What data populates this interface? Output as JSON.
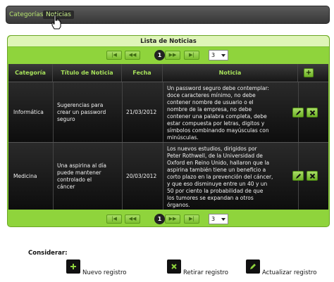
{
  "menu": {
    "items": [
      {
        "label": "Categorías"
      },
      {
        "label": "Noticias"
      }
    ]
  },
  "grid": {
    "title": "Lista de Noticias",
    "pager": {
      "first": "|◀",
      "prev": "◀◀",
      "current_page": "1",
      "next": "▶▶",
      "last": "▶|",
      "page_size": "3"
    },
    "columns": [
      "Categoría",
      "Título de Noticia",
      "Fecha",
      "Noticia"
    ],
    "add_label": "+",
    "rows": [
      {
        "category": "Informática",
        "title_lines": [
          "Sugerencias para",
          "crear un password",
          "seguro"
        ],
        "date": "21/03/2012",
        "body_lines": [
          "Un password seguro debe contemplar:",
          "doce caracteres mínimo, no debe",
          "contener nombre de usuario o el",
          "nombre de la empresa, no debe",
          "contener una palabra completa, debe",
          "estar compuesta por letras, digitos y",
          "símbolos combinando mayúsculas con",
          "minúsculas."
        ]
      },
      {
        "category": "Medicina",
        "title_lines": [
          "Una aspirina al día",
          "puede mantener",
          "controlado el",
          "cáncer"
        ],
        "date": "20/03/2012",
        "body_lines": [
          "Los nuevos estudios, dirigidos por",
          "Peter Rothwell, de la Universidad de",
          "Oxford en Reino Unido, hallaron que la",
          "aspirina también tiene un beneficio a",
          "corto plazo en la prevención del cáncer,",
          "y que eso disminuye entre un 40 y un",
          "50 por ciento la probabilidad de que",
          "los tumores se expandan a otros",
          "órganos."
        ]
      }
    ]
  },
  "legend": {
    "title": "Considerar:",
    "new": "Nuevo registro",
    "remove": "Retirar registro",
    "update": "Actualizar registro"
  },
  "colors": {
    "accent_green": "#8fd43c",
    "header_dark": "#171717",
    "menu_text": "#b6e36e"
  }
}
